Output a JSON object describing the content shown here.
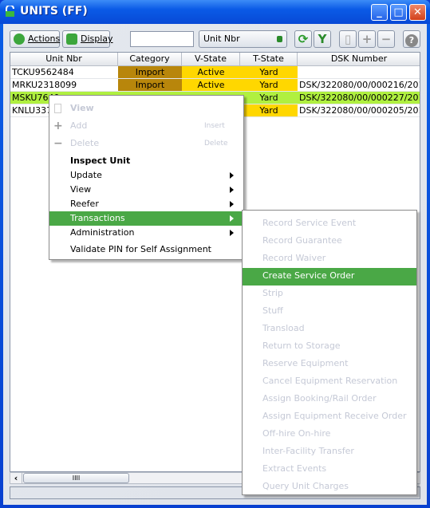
{
  "window": {
    "title": "UNITS (FF)",
    "minimize": "_",
    "maximize": "□",
    "close": "✕"
  },
  "toolbar": {
    "actions_label": "Actions",
    "display_label": "Display",
    "search_value": "",
    "field_select": "Unit Nbr",
    "refresh": "⟳",
    "filter": "Y",
    "view": "▯",
    "add": "+",
    "remove": "−",
    "help": "?"
  },
  "table": {
    "columns": [
      "Unit Nbr",
      "Category",
      "V-State",
      "T-State",
      "DSK Number"
    ],
    "rows": [
      {
        "unit": "TCKU9562484",
        "category": "Import",
        "vstate": "Active",
        "tstate": "Yard",
        "dsk": ""
      },
      {
        "unit": "MRKU2318099",
        "category": "Import",
        "vstate": "Active",
        "tstate": "Yard",
        "dsk": "DSK/322080/00/000216/2012"
      },
      {
        "unit": "MSKU7640",
        "category": "",
        "vstate": "",
        "tstate": "Yard",
        "dsk": "DSK/322080/00/000227/2012"
      },
      {
        "unit": "KNLU3376",
        "category": "",
        "vstate": "",
        "tstate": "Yard",
        "dsk": "DSK/322080/00/000205/2012"
      }
    ],
    "colors": {
      "category": "#b8860b",
      "state": "#ffd700",
      "selected": "#b0f040"
    }
  },
  "scrollbar": {
    "grip": "IIII"
  },
  "context_menu": {
    "items": [
      {
        "label": "View",
        "disabled": true
      },
      {
        "label": "Add",
        "shortcut": "Insert",
        "disabled": true
      },
      {
        "label": "Delete",
        "shortcut": "Delete",
        "disabled": true
      },
      {
        "label": "Inspect Unit"
      },
      {
        "label": "Update"
      },
      {
        "label": "View"
      },
      {
        "label": "Reefer"
      },
      {
        "label": "Transactions",
        "highlighted": true
      },
      {
        "label": "Administration"
      },
      {
        "label": "Validate  PIN for Self Assignment"
      }
    ]
  },
  "submenu": {
    "items": [
      "Record Service Event",
      "Record Guarantee",
      "Record Waiver",
      "Create Service Order",
      "Strip",
      "Stuff",
      "Transload",
      "Return to Storage",
      "Reserve Equipment",
      "Cancel Equipment Reservation",
      "Assign Booking/Rail Order",
      "Assign Equipment Receive Order",
      "Off-hire On-hire",
      "Inter-Facility Transfer",
      "Extract Events",
      "Query Unit Charges"
    ],
    "highlighted": "Create Service Order",
    "highlight_color": "#4aa846"
  }
}
